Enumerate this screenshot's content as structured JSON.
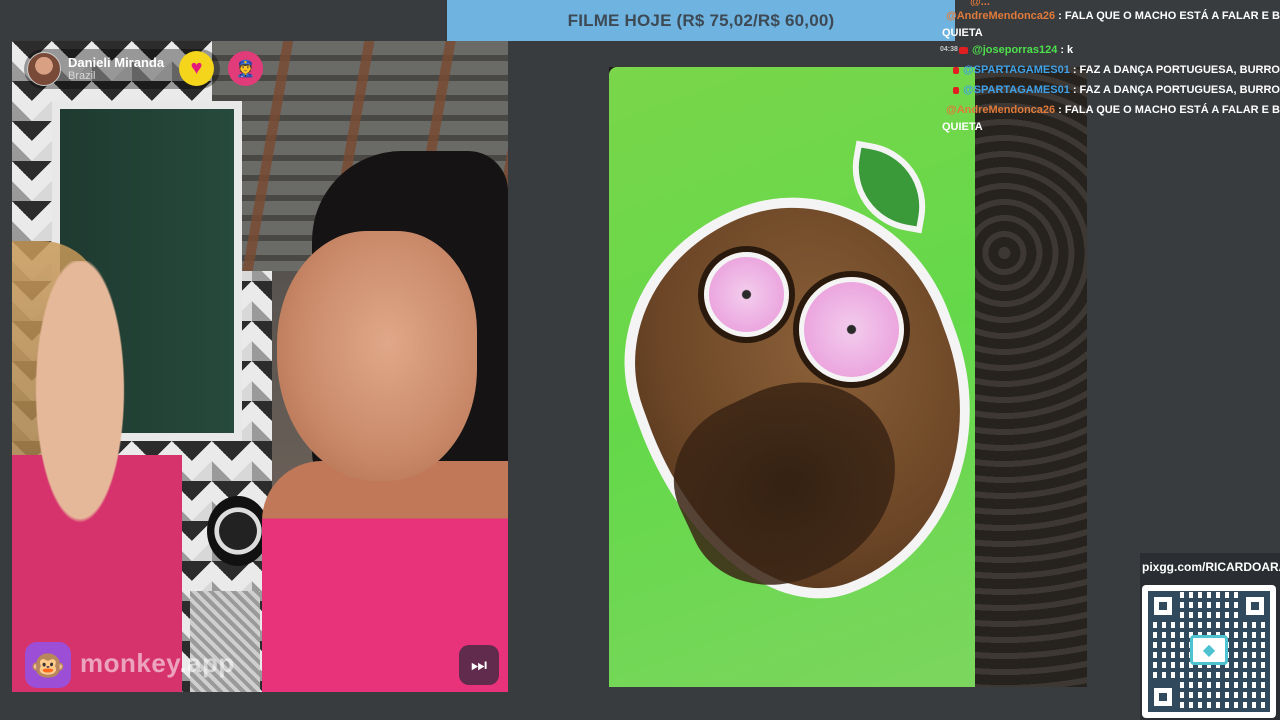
{
  "banner": {
    "text": "FILME HOJE (R$ 75,02/R$ 60,00)"
  },
  "left_video": {
    "user": {
      "name": "Danieli Miranda",
      "country": "Brazil"
    },
    "badges": [
      "heart-icon",
      "police-icon"
    ],
    "app_name": "monkey.app",
    "icons": {
      "logo": "monkey-icon",
      "skip": "fast-forward-icon"
    }
  },
  "chat": {
    "lines": [
      {
        "time": "",
        "user": "@AndreMendonca26",
        "user_color": "#e07a3a",
        "message": ": FALA QUE O MACHO ESTÁ A FALAR E BOTA",
        "continuation": "QUIETA"
      },
      {
        "time": "04:38",
        "user": "@joseporras124",
        "user_color": "#4ce04c",
        "message": ": k",
        "continuation": ""
      },
      {
        "time": "",
        "user": "@SPARTAGAMES01",
        "user_color": "#3fa2e8",
        "message": ": FAZ A DANÇA PORTUGUESA, BURRO",
        "continuation": ""
      },
      {
        "time": "",
        "user": "@SPARTAGAMES01",
        "user_color": "#3fa2e8",
        "message": ": FAZ A DANÇA PORTUGUESA, BURRO",
        "continuation": ""
      },
      {
        "time": "",
        "user": "@AndreMendonca26",
        "user_color": "#e07a3a",
        "message": ": FALA QUE O MACHO ESTÁ A FALAR E BOTA",
        "continuation": "QUIETA"
      }
    ]
  },
  "donation": {
    "url": "pixgg.com/RICARDOARAUJO"
  },
  "colors": {
    "banner_bg": "#6fb4e0",
    "background": "#393c3f",
    "bean_screen": "#64d84a"
  }
}
